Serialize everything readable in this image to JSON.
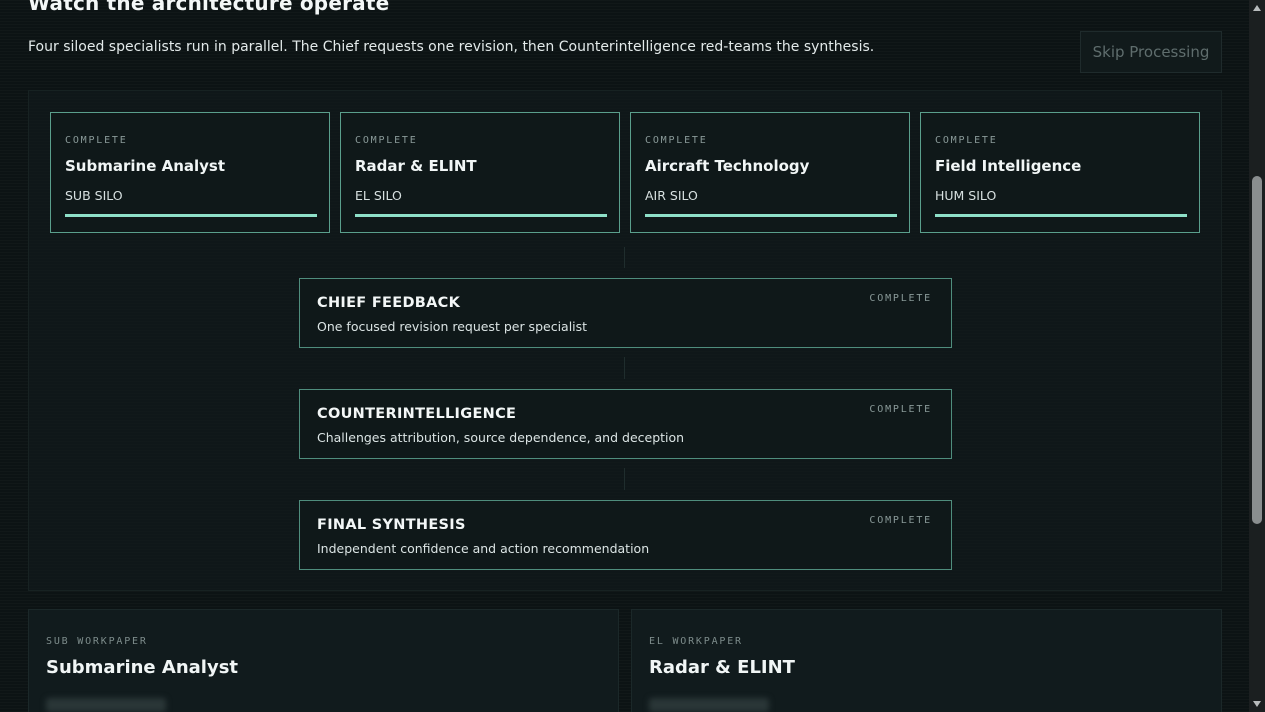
{
  "header": {
    "title": "Watch the architecture operate",
    "subtitle": "Four siloed specialists run in parallel. The Chief requests one revision, then Counterintelligence red-teams the synthesis.",
    "skip_label": "Skip Processing"
  },
  "specialists": [
    {
      "status": "COMPLETE",
      "name": "Submarine Analyst",
      "silo": "SUB SILO",
      "progress": 1.0
    },
    {
      "status": "COMPLETE",
      "name": "Radar & ELINT",
      "silo": "EL SILO",
      "progress": 1.0
    },
    {
      "status": "COMPLETE",
      "name": "Aircraft Technology",
      "silo": "AIR SILO",
      "progress": 1.0
    },
    {
      "status": "COMPLETE",
      "name": "Field Intelligence",
      "silo": "HUM SILO",
      "progress": 1.0
    }
  ],
  "stages": [
    {
      "title": "CHIEF FEEDBACK",
      "desc": "One focused revision request per specialist",
      "status": "COMPLETE"
    },
    {
      "title": "COUNTERINTELLIGENCE",
      "desc": "Challenges attribution, source dependence, and deception",
      "status": "COMPLETE"
    },
    {
      "title": "FINAL SYNTHESIS",
      "desc": "Independent confidence and action recommendation",
      "status": "COMPLETE"
    }
  ],
  "workpapers": [
    {
      "label": "SUB WORKPAPER",
      "name": "Submarine Analyst"
    },
    {
      "label": "EL WORKPAPER",
      "name": "Radar & ELINT"
    }
  ],
  "colors": {
    "accent": "#8ee0c8",
    "card_border": "#5a9f8c",
    "background": "#0c1314"
  },
  "icons": {
    "scroll_up": "triangle-up-icon",
    "scroll_down": "triangle-down-icon"
  }
}
